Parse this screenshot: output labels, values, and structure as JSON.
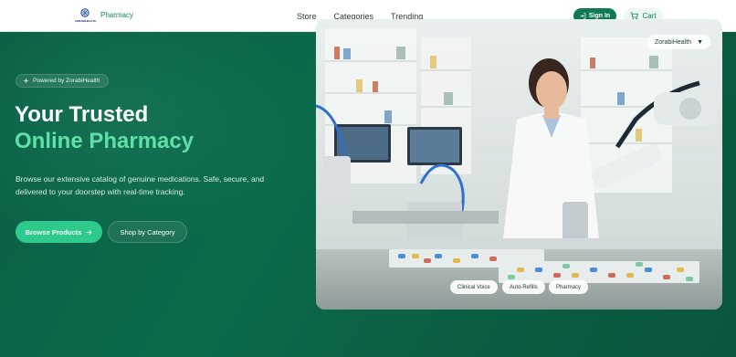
{
  "nav": {
    "logo_text": "ZORABIHEALTH",
    "brand": "Pharmacy",
    "links": [
      "Store",
      "Categories",
      "Trending"
    ],
    "signin_label": "Sign In",
    "cart_label": "Cart"
  },
  "hero": {
    "badge": "Powered by ZorabiHealth",
    "title_line1": "Your Trusted",
    "title_line2": "Online Pharmacy",
    "description": "Browse our extensive catalog of genuine medications. Safe, secure, and delivered to your doorstep with real-time tracking.",
    "primary_button": "Browse Products",
    "secondary_button": "Shop by Category"
  },
  "image": {
    "dropdown_label": "ZorabiHealth",
    "chips": [
      "Clinical Voice",
      "Auto-Refills",
      "Pharmacy"
    ]
  },
  "colors": {
    "brand_green": "#0d7a55",
    "accent_green": "#2ec98c",
    "hero_bg": "#0b6349",
    "title_accent": "#5fe0a8"
  },
  "icons": [
    "logo-icon",
    "sign-in-icon",
    "cart-icon",
    "sparkle-icon",
    "arrow-right-icon",
    "chevron-down-icon"
  ]
}
